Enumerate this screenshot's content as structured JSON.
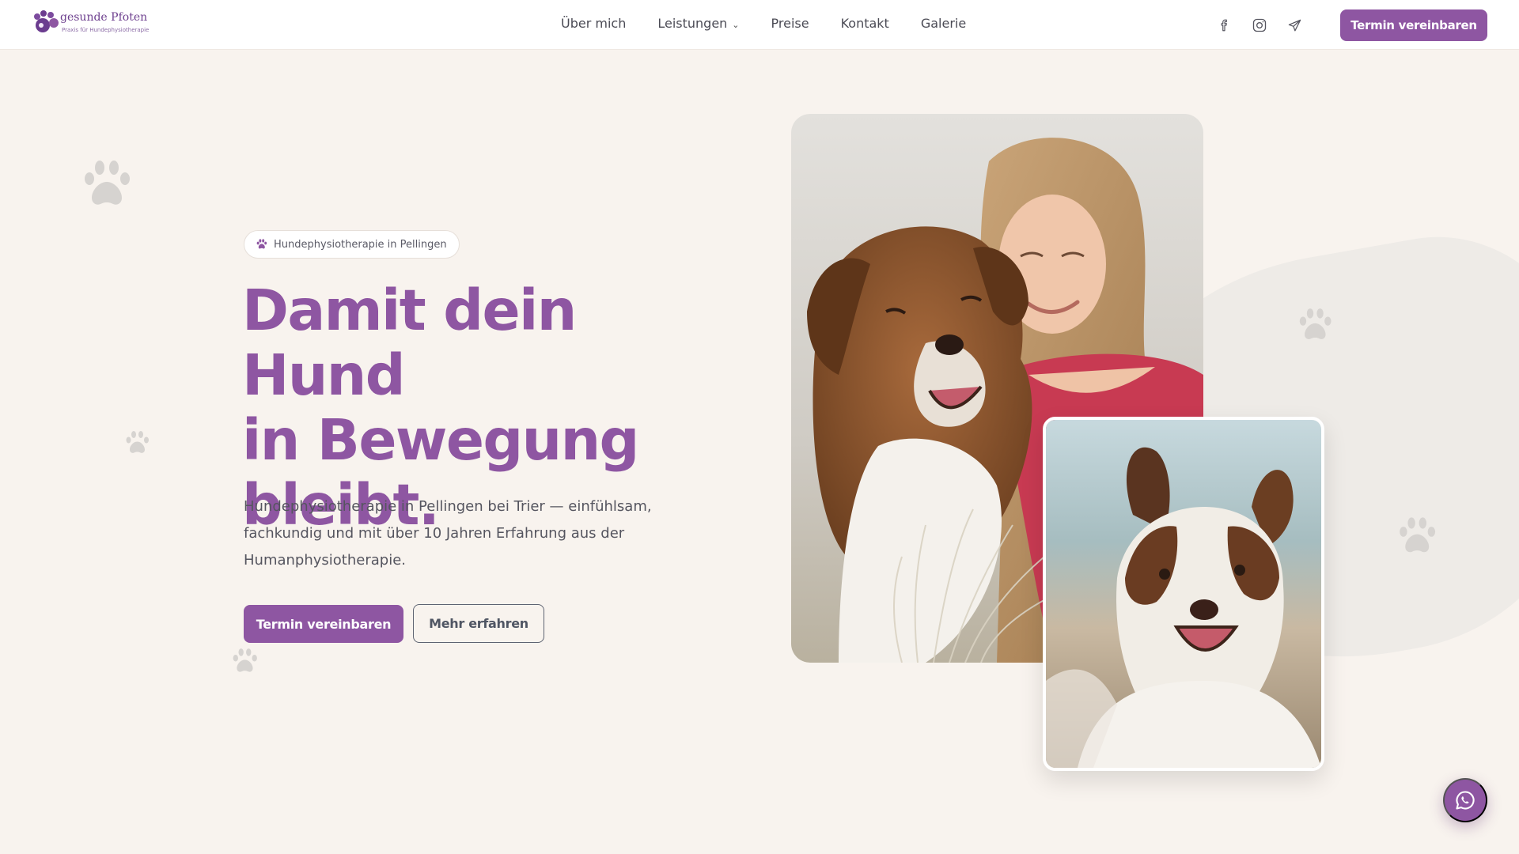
{
  "nav": {
    "logo_title": "gesunde Pfoten",
    "logo_subtitle": "Praxis für Hundephysiotherapie",
    "menu": [
      {
        "label": "Über mich"
      },
      {
        "label": "Leistungen",
        "has_dropdown": true
      },
      {
        "label": "Preise"
      },
      {
        "label": "Kontakt"
      },
      {
        "label": "Galerie"
      }
    ],
    "social_icons": [
      "facebook-icon",
      "instagram-icon",
      "send-icon"
    ],
    "cta_label": "Termin vereinbaren"
  },
  "hero": {
    "tag": "Hundephysiotherapie in Pellingen",
    "title_lines": [
      "Damit dein Hund",
      "in Bewegung",
      "bleibt."
    ],
    "description": "Hundephysiotherapie in Pellingen bei Trier — einfühlsam, fachkundig und mit über 10 Jahren Erfahrung aus der Humanphysiotherapie.",
    "primary_button": "Termin vereinbaren",
    "secondary_button": "Mehr erfahren",
    "images": [
      {
        "subject": "woman-with-australian-shepherd-photo"
      },
      {
        "subject": "australian-shepherd-portrait-photo"
      }
    ]
  },
  "fab": {
    "icon": "whatsapp-icon"
  },
  "colors": {
    "accent": "#8e56a2",
    "background": "#f8f3ee",
    "nav_background": "#ffffff",
    "text": "#4a4a55"
  }
}
